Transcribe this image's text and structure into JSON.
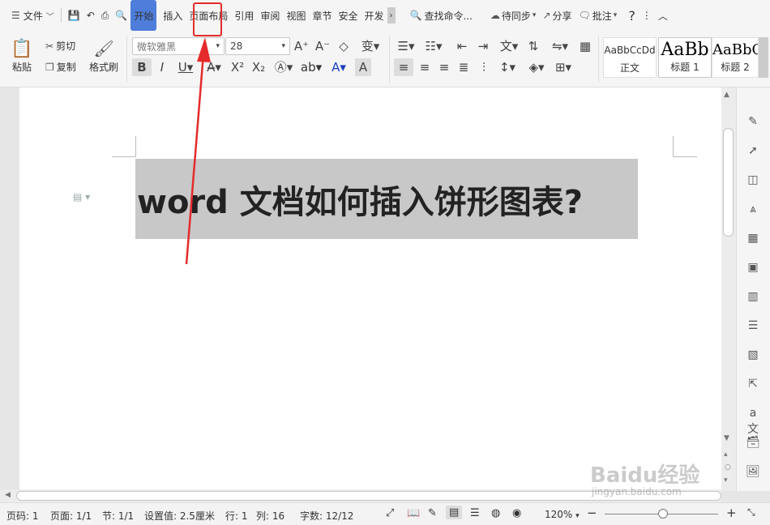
{
  "tabbar": {
    "menu_label": "文件",
    "tabs": [
      "开始",
      "插入",
      "页面布局",
      "引用",
      "审阅",
      "视图",
      "章节",
      "安全",
      "开发"
    ],
    "search_label": "查找命令...",
    "sync_label": "待同步",
    "share_label": "分享",
    "comment_label": "批注",
    "help_label": "?"
  },
  "ribbon": {
    "paste_label": "粘贴",
    "cut_label": "剪切",
    "copy_label": "复制",
    "format_painter_label": "格式刷",
    "font_name": "微软雅黑",
    "font_size": "28",
    "styles": [
      {
        "preview": "AaBbCcDd",
        "label": "正文"
      },
      {
        "preview": "AaBb",
        "label": "标题 1"
      },
      {
        "preview": "AaBbC",
        "label": "标题 2"
      }
    ]
  },
  "document": {
    "heading_text": "word 文档如何插入饼形图表?"
  },
  "status": {
    "page_no": "页码: 1",
    "page_count": "页面: 1/1",
    "section": "节: 1/1",
    "setting": "设置值: 2.5厘米",
    "row": "行: 1",
    "col": "列: 16",
    "word_count": "字数: 12/12",
    "zoom": "120%"
  },
  "watermark": {
    "brand": "Baidu经验",
    "url": "jingyan.baidu.com"
  },
  "colors": {
    "accent": "#4e7ddb",
    "highlight_box": "#e52b2b",
    "heading_bg": "#c8c8c8"
  }
}
